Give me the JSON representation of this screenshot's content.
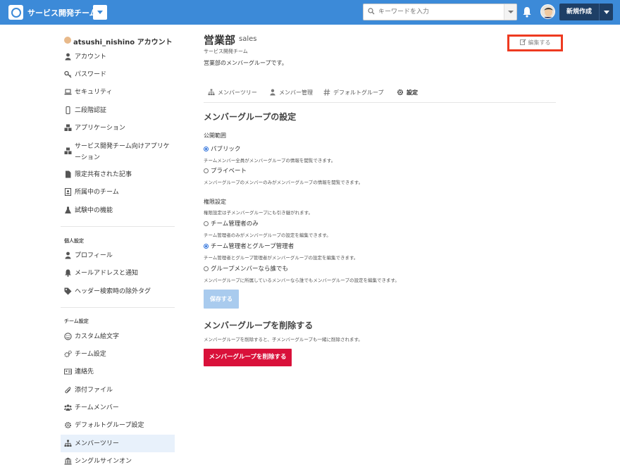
{
  "header": {
    "team_name": "サービス開発チーム",
    "search_placeholder": "キーワードを入力",
    "new_post": "新規作成"
  },
  "sidebar": {
    "account_title": "atsushi_nishino アカウント",
    "items": [
      {
        "label": "アカウント",
        "icon": "user-icon"
      },
      {
        "label": "パスワード",
        "icon": "key-icon"
      },
      {
        "label": "セキュリティ",
        "icon": "laptop-icon"
      },
      {
        "label": "二段階認証",
        "icon": "mobile-icon"
      },
      {
        "label": "アプリケーション",
        "icon": "cubes-icon"
      },
      {
        "label": "サービス開発チーム向けアプリケーション",
        "icon": "cubes-icon"
      },
      {
        "label": "限定共有された記事",
        "icon": "file-icon"
      },
      {
        "label": "所属中のチーム",
        "icon": "id-card-icon"
      },
      {
        "label": "試験中の機能",
        "icon": "flask-icon"
      }
    ],
    "personal_section": "個人設定",
    "personal_items": [
      {
        "label": "プロフィール",
        "icon": "user-icon"
      },
      {
        "label": "メールアドレスと通知",
        "icon": "bell-icon"
      },
      {
        "label": "ヘッダー検索時の除外タグ",
        "icon": "tag-icon"
      }
    ],
    "team_section": "チーム設定",
    "team_items": [
      {
        "label": "カスタム絵文字",
        "icon": "smile-icon"
      },
      {
        "label": "チーム設定",
        "icon": "cogs-icon"
      },
      {
        "label": "連絡先",
        "icon": "address-card-icon"
      },
      {
        "label": "添付ファイル",
        "icon": "paperclip-icon"
      },
      {
        "label": "チームメンバー",
        "icon": "users-icon"
      },
      {
        "label": "デフォルトグループ設定",
        "icon": "cog-icon"
      },
      {
        "label": "メンバーツリー",
        "icon": "sitemap-icon"
      },
      {
        "label": "シングルサインオン",
        "icon": "bank-icon"
      }
    ]
  },
  "group": {
    "name": "営業部",
    "slug": "sales",
    "team": "サービス開発チーム",
    "description": "営業部のメンバーグループです。",
    "edit_label": "編集する"
  },
  "tabs": [
    {
      "label": "メンバーツリー",
      "icon": "sitemap-icon"
    },
    {
      "label": "メンバー管理",
      "icon": "user-icon"
    },
    {
      "label": "デフォルトグループ",
      "icon": "hashtag-icon"
    },
    {
      "label": "設定",
      "icon": "cog-icon"
    }
  ],
  "settings": {
    "title": "メンバーグループの設定",
    "visibility_label": "公開範囲",
    "public_label": "パブリック",
    "public_help": "チームメンバー全員がメンバーグループの情報を閲覧できます。",
    "private_label": "プライベート",
    "private_help": "メンバーグループのメンバーのみがメンバーグループの情報を閲覧できます。",
    "perm_label": "権限設定",
    "perm_help": "権限設定は子メンバーグループにも引き継がれます。",
    "perm_team_admin": "チーム管理者のみ",
    "perm_team_admin_help": "チーム管理者のみがメンバーグループの設定を編集できます。",
    "perm_team_group_admin": "チーム管理者とグループ管理者",
    "perm_team_group_admin_help": "チーム管理者とグループ管理者がメンバーグループの設定を編集できます。",
    "perm_anyone": "グループメンバーなら誰でも",
    "perm_anyone_help": "メンバーグループに所属しているメンバーなら誰でもメンバーグループの設定を編集できます。",
    "save_label": "保存する"
  },
  "delete": {
    "title": "メンバーグループを削除する",
    "help": "メンバーグループを削除すると、子メンバーグループも一緒に削除されます。",
    "button": "メンバーグループを削除する"
  },
  "colors": {
    "topbar": "#3c8ad8",
    "danger": "#d9113a",
    "highlight": "#ee3a20",
    "save_disabled": "#a9cbee"
  }
}
